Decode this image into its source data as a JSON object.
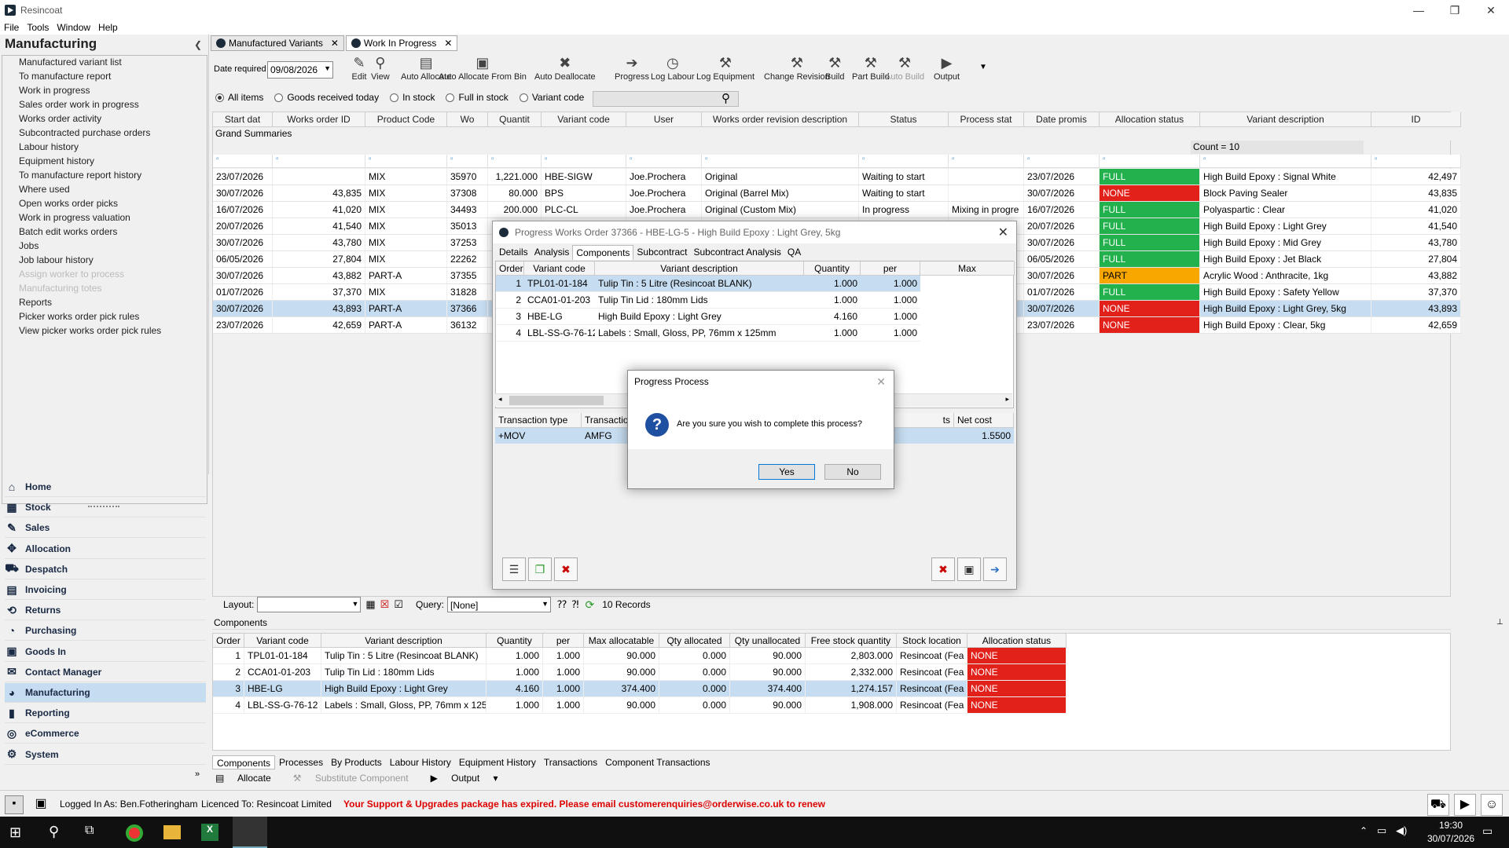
{
  "app": {
    "title": "Resincoat",
    "menu": [
      "File",
      "Tools",
      "Window",
      "Help"
    ]
  },
  "left": {
    "title": "Manufacturing",
    "items": [
      {
        "label": "Manufactured variant list",
        "disabled": false
      },
      {
        "label": "To manufacture report",
        "disabled": false
      },
      {
        "label": "Work in progress",
        "disabled": false
      },
      {
        "label": "Sales order work in progress",
        "disabled": false
      },
      {
        "label": "Works order activity",
        "disabled": false
      },
      {
        "label": "Subcontracted purchase orders",
        "disabled": false
      },
      {
        "label": "Labour history",
        "disabled": false
      },
      {
        "label": "Equipment history",
        "disabled": false
      },
      {
        "label": "To manufacture report history",
        "disabled": false
      },
      {
        "label": "Where used",
        "disabled": false
      },
      {
        "label": "Open works order picks",
        "disabled": false
      },
      {
        "label": "Work in progress valuation",
        "disabled": false
      },
      {
        "label": "Batch edit works orders",
        "disabled": false
      },
      {
        "label": "Jobs",
        "disabled": false
      },
      {
        "label": "Job labour history",
        "disabled": false
      },
      {
        "label": "Assign worker to process",
        "disabled": true
      },
      {
        "label": "Manufacturing totes",
        "disabled": true
      },
      {
        "label": "Reports",
        "disabled": false
      },
      {
        "label": "Picker works order pick rules",
        "disabled": false
      },
      {
        "label": "View picker works order pick rules",
        "disabled": false
      }
    ]
  },
  "nav": [
    {
      "label": "Home",
      "icon": "home-icon",
      "glyph": "⌂"
    },
    {
      "label": "Stock",
      "icon": "stock-icon",
      "glyph": "▦"
    },
    {
      "label": "Sales",
      "icon": "sales-icon",
      "glyph": "✎"
    },
    {
      "label": "Allocation",
      "icon": "allocation-icon",
      "glyph": "✥"
    },
    {
      "label": "Despatch",
      "icon": "despatch-icon",
      "glyph": "⛟"
    },
    {
      "label": "Invoicing",
      "icon": "invoicing-icon",
      "glyph": "▤"
    },
    {
      "label": "Returns",
      "icon": "returns-icon",
      "glyph": "⟲"
    },
    {
      "label": "Purchasing",
      "icon": "purchasing-icon",
      "glyph": "◔"
    },
    {
      "label": "Goods In",
      "icon": "goods-in-icon",
      "glyph": "▣"
    },
    {
      "label": "Contact Manager",
      "icon": "contact-manager-icon",
      "glyph": "✉"
    },
    {
      "label": "Manufacturing",
      "icon": "manufacturing-icon",
      "glyph": "◕",
      "active": true
    },
    {
      "label": "Reporting",
      "icon": "reporting-icon",
      "glyph": "▮"
    },
    {
      "label": "eCommerce",
      "icon": "ecommerce-icon",
      "glyph": "◎"
    },
    {
      "label": "System",
      "icon": "system-icon",
      "glyph": "⚙"
    }
  ],
  "tabs": [
    {
      "label": "Manufactured Variants"
    },
    {
      "label": "Work In Progress"
    }
  ],
  "toolbar": {
    "date_label": "Date required",
    "date_value": "09/08/2026",
    "buttons": [
      {
        "label": "Edit",
        "icon": "pencil-icon",
        "glyph": "✎"
      },
      {
        "label": "View",
        "icon": "magnifier-icon",
        "glyph": "⚲"
      },
      {
        "label": "Auto Allocate",
        "icon": "auto-allocate-icon",
        "glyph": "▤"
      },
      {
        "label": "Auto Allocate From Bin",
        "icon": "bin-icon",
        "glyph": "▣"
      },
      {
        "label": "Auto Deallocate",
        "icon": "deallocate-icon",
        "glyph": "✖"
      },
      {
        "label": "Progress",
        "icon": "progress-icon",
        "glyph": "➔"
      },
      {
        "label": "Log Labour",
        "icon": "clock-icon",
        "glyph": "◷"
      },
      {
        "label": "Log Equipment",
        "icon": "equipment-icon",
        "glyph": "⚒"
      },
      {
        "label": "Change Revision",
        "icon": "revision-icon",
        "glyph": "⚒"
      },
      {
        "label": "Build",
        "icon": "build-icon",
        "glyph": "⚒"
      },
      {
        "label": "Part Build",
        "icon": "part-build-icon",
        "glyph": "⚒"
      },
      {
        "label": "Auto Build",
        "icon": "auto-build-icon",
        "glyph": "⚒",
        "disabled": true
      },
      {
        "label": "Output",
        "icon": "output-icon",
        "glyph": "▶"
      }
    ]
  },
  "filters": {
    "options": [
      "All items",
      "Goods received today",
      "In stock",
      "Full in stock",
      "Variant code"
    ],
    "selected": "All items"
  },
  "grid": {
    "columns": [
      "Start dat",
      "Works order ID",
      "Product Code",
      "Wo",
      "Quantit",
      "Variant code",
      "User",
      "Works order revision description",
      "Status",
      "Process stat",
      "Date promis",
      "Allocation status",
      "Variant description",
      "ID"
    ],
    "grand_summaries": "Grand Summaries",
    "count": "Count = 10",
    "rows": [
      {
        "start": "23/07/2026",
        "woid": "",
        "product": "MIX",
        "wo": "35970",
        "qty": "1,221.000",
        "variant": "HBE-SIGW",
        "user": "Joe.Prochera",
        "revision": "Original",
        "status": "Waiting to start",
        "process": "",
        "promised": "23/07/2026",
        "alloc": "FULL",
        "desc": "High Build Epoxy : Signal White",
        "id": "42,497"
      },
      {
        "start": "30/07/2026",
        "woid": "43,835",
        "product": "MIX",
        "wo": "37308",
        "qty": "80.000",
        "variant": "BPS",
        "user": "Joe.Prochera",
        "revision": "Original (Barrel Mix)",
        "status": "Waiting to start",
        "process": "",
        "promised": "30/07/2026",
        "alloc": "NONE",
        "desc": "Block Paving Sealer",
        "id": "43,835"
      },
      {
        "start": "16/07/2026",
        "woid": "41,020",
        "product": "MIX",
        "wo": "34493",
        "qty": "200.000",
        "variant": "PLC-CL",
        "user": "Joe.Prochera",
        "revision": "Original (Custom Mix)",
        "status": "In progress",
        "process": "Mixing in progre",
        "promised": "16/07/2026",
        "alloc": "FULL",
        "desc": "Polyaspartic : Clear",
        "id": "41,020"
      },
      {
        "start": "20/07/2026",
        "woid": "41,540",
        "product": "MIX",
        "wo": "35013",
        "qty": "",
        "variant": "",
        "user": "",
        "revision": "",
        "status": "",
        "process": "",
        "promised": "20/07/2026",
        "alloc": "FULL",
        "desc": "High Build Epoxy : Light Grey",
        "id": "41,540"
      },
      {
        "start": "30/07/2026",
        "woid": "43,780",
        "product": "MIX",
        "wo": "37253",
        "qty": "",
        "variant": "",
        "user": "",
        "revision": "",
        "status": "",
        "process": "",
        "promised": "30/07/2026",
        "alloc": "FULL",
        "desc": "High Build Epoxy : Mid Grey",
        "id": "43,780"
      },
      {
        "start": "06/05/2026",
        "woid": "27,804",
        "product": "MIX",
        "wo": "22262",
        "qty": "",
        "variant": "",
        "user": "",
        "revision": "",
        "status": "",
        "process": "",
        "promised": "06/05/2026",
        "alloc": "FULL",
        "desc": "High Build Epoxy : Jet Black",
        "id": "27,804"
      },
      {
        "start": "30/07/2026",
        "woid": "43,882",
        "product": "PART-A",
        "wo": "37355",
        "qty": "",
        "variant": "",
        "user": "",
        "revision": "",
        "status": "",
        "process": "",
        "promised": "30/07/2026",
        "alloc": "PART",
        "desc": "Acrylic Wood : Anthracite, 1kg",
        "id": "43,882"
      },
      {
        "start": "01/07/2026",
        "woid": "37,370",
        "product": "MIX",
        "wo": "31828",
        "qty": "",
        "variant": "",
        "user": "",
        "revision": "",
        "status": "",
        "process": "",
        "promised": "01/07/2026",
        "alloc": "FULL",
        "desc": "High Build Epoxy : Safety Yellow",
        "id": "37,370"
      },
      {
        "start": "30/07/2026",
        "woid": "43,893",
        "product": "PART-A",
        "wo": "37366",
        "qty": "",
        "variant": "",
        "user": "",
        "revision": "",
        "status": "",
        "process": "",
        "promised": "30/07/2026",
        "alloc": "NONE",
        "desc": "High Build Epoxy : Light Grey, 5kg",
        "id": "43,893",
        "selected": true
      },
      {
        "start": "23/07/2026",
        "woid": "42,659",
        "product": "PART-A",
        "wo": "36132",
        "qty": "",
        "variant": "",
        "user": "",
        "revision": "",
        "status": "",
        "process": "",
        "promised": "23/07/2026",
        "alloc": "NONE",
        "desc": "High Build Epoxy : Clear, 5kg",
        "id": "42,659"
      }
    ]
  },
  "dialog": {
    "title": "Progress Works Order 37366 - HBE-LG-5 - High Build Epoxy : Light Grey, 5kg",
    "tabs": [
      "Details",
      "Analysis",
      "Components",
      "Subcontract",
      "Subcontract Analysis",
      "QA"
    ],
    "active_tab": "Components",
    "columns": [
      "Order",
      "Variant code",
      "Variant description",
      "Quantity",
      "per",
      "Max"
    ],
    "rows": [
      {
        "order": "1",
        "code": "TPL01-01-184",
        "desc": "Tulip Tin : 5 Litre (Resincoat BLANK)",
        "qty": "1.000",
        "per": "1.000"
      },
      {
        "order": "2",
        "code": "CCA01-01-203",
        "desc": "Tulip Tin Lid : 180mm Lids",
        "qty": "1.000",
        "per": "1.000"
      },
      {
        "order": "3",
        "code": "HBE-LG",
        "desc": "High Build Epoxy : Light Grey",
        "qty": "4.160",
        "per": "1.000"
      },
      {
        "order": "4",
        "code": "LBL-SS-G-76-125",
        "desc": "Labels : Small, Gloss, PP, 76mm x 125mm",
        "qty": "1.000",
        "per": "1.000"
      }
    ],
    "tx_columns": [
      "Transaction type",
      "Transactio",
      "ts",
      "Net cost"
    ],
    "tx_row": {
      "type": "+MOV",
      "trans": "AMFG",
      "net": "1.5500"
    }
  },
  "confirm": {
    "title": "Progress Process",
    "message": "Are you sure you wish to complete this process?",
    "yes": "Yes",
    "no": "No"
  },
  "layoutbar": {
    "layout_label": "Layout:",
    "query_label": "Query:",
    "query_value": "[None]",
    "records": "10 Records"
  },
  "components": {
    "title": "Components",
    "columns": [
      "Order",
      "Variant code",
      "Variant description",
      "Quantity",
      "per",
      "Max allocatable",
      "Qty allocated",
      "Qty unallocated",
      "Free stock quantity",
      "Stock location",
      "Allocation status"
    ],
    "rows": [
      {
        "order": "1",
        "code": "TPL01-01-184",
        "desc": "Tulip Tin : 5 Litre (Resincoat BLANK)",
        "qty": "1.000",
        "per": "1.000",
        "max": "90.000",
        "alloc": "0.000",
        "unalloc": "90.000",
        "free": "2,803.000",
        "loc": "Resincoat (Fea",
        "status": "NONE"
      },
      {
        "order": "2",
        "code": "CCA01-01-203",
        "desc": "Tulip Tin Lid : 180mm Lids",
        "qty": "1.000",
        "per": "1.000",
        "max": "90.000",
        "alloc": "0.000",
        "unalloc": "90.000",
        "free": "2,332.000",
        "loc": "Resincoat (Fea",
        "status": "NONE"
      },
      {
        "order": "3",
        "code": "HBE-LG",
        "desc": "High Build Epoxy : Light Grey",
        "qty": "4.160",
        "per": "1.000",
        "max": "374.400",
        "alloc": "0.000",
        "unalloc": "374.400",
        "free": "1,274.157",
        "loc": "Resincoat (Fea",
        "status": "NONE",
        "selected": true
      },
      {
        "order": "4",
        "code": "LBL-SS-G-76-12",
        "desc": "Labels : Small, Gloss, PP, 76mm x 125m",
        "qty": "1.000",
        "per": "1.000",
        "max": "90.000",
        "alloc": "0.000",
        "unalloc": "90.000",
        "free": "1,908.000",
        "loc": "Resincoat (Fea",
        "status": "NONE"
      }
    ],
    "tabs": [
      "Components",
      "Processes",
      "By Products",
      "Labour History",
      "Equipment History",
      "Transactions",
      "Component Transactions"
    ],
    "actions": [
      "Allocate",
      "Substitute Component",
      "Output"
    ]
  },
  "status": {
    "logged": "Logged In As: Ben.Fotheringham",
    "licence": "Licenced To: Resincoat Limited",
    "warning": "Your Support & Upgrades package has expired. Please email customerenquiries@orderwise.co.uk to renew"
  },
  "taskbar": {
    "time": "19:30",
    "date": "30/07/2026"
  }
}
